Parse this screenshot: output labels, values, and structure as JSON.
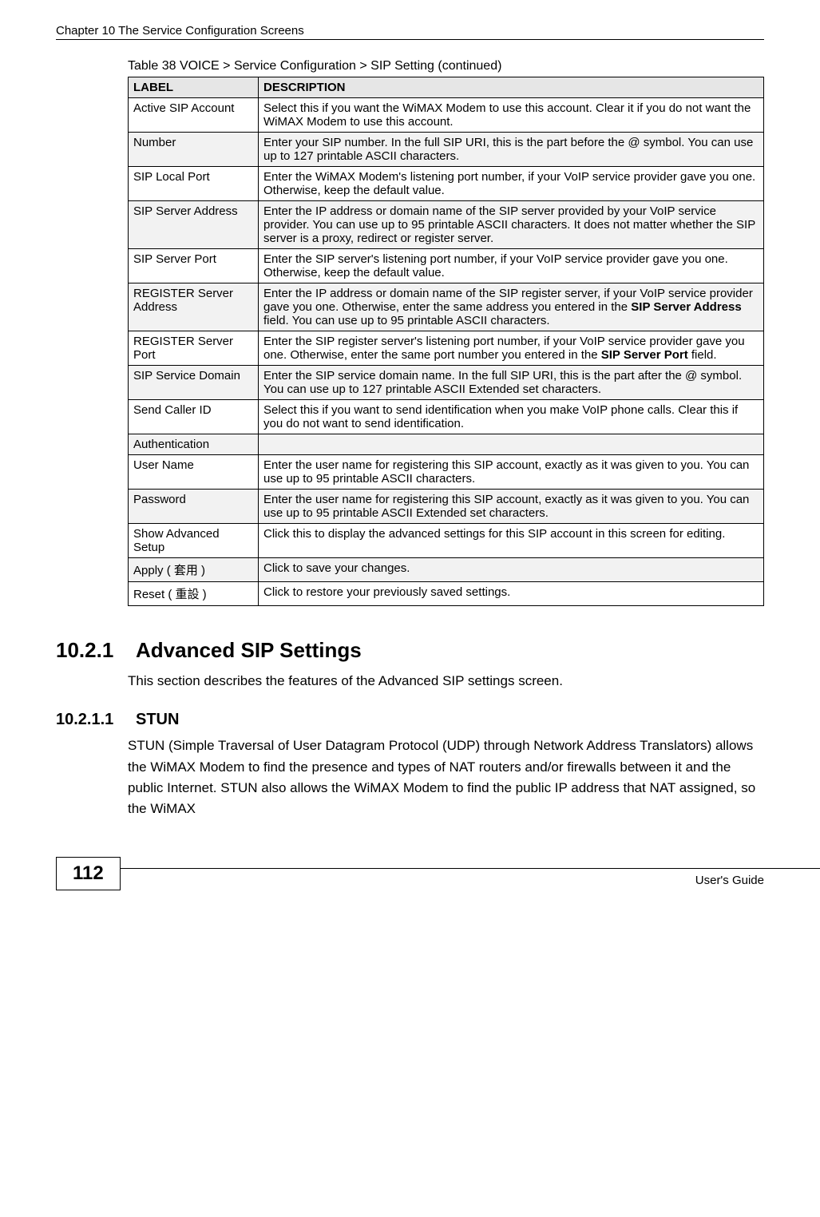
{
  "chapterTitle": "Chapter 10 The Service Configuration Screens",
  "tableCaption": "Table 38   VOICE > Service Configuration > SIP Setting (continued)",
  "headers": {
    "label": "LABEL",
    "description": "DESCRIPTION"
  },
  "rows": [
    {
      "label": "Active SIP Account",
      "indent": false,
      "shade": false,
      "desc": "Select this if you want the WiMAX Modem to use this account. Clear it if you do not want the WiMAX Modem to use this account."
    },
    {
      "label": "Number",
      "indent": true,
      "shade": true,
      "desc": "Enter your SIP number. In the full SIP URI, this is the part before the @ symbol.  You can use up to 127 printable ASCII characters."
    },
    {
      "label": "SIP Local Port",
      "indent": true,
      "shade": false,
      "desc": "Enter the WiMAX Modem's listening port number, if your VoIP service provider gave you one. Otherwise, keep the default value."
    },
    {
      "label": "SIP Server Address",
      "indent": true,
      "shade": true,
      "desc": "Enter the IP address or domain name of the SIP server provided by your VoIP service provider. You can use up to 95 printable ASCII characters. It does not matter whether the SIP server is a proxy, redirect or register server."
    },
    {
      "label": "SIP Server Port",
      "indent": true,
      "shade": false,
      "desc": "Enter the SIP server's listening port number, if your VoIP service provider gave you one. Otherwise, keep the default value."
    },
    {
      "label": "REGISTER Server Address",
      "indent": true,
      "shade": true,
      "descParts": [
        "Enter the IP address or domain name of the SIP register server, if your VoIP service provider gave you one. Otherwise, enter the same address you entered in the ",
        "SIP Server Address",
        " field. You can use up to 95 printable ASCII characters."
      ]
    },
    {
      "label": "REGISTER Server Port",
      "indent": true,
      "shade": false,
      "descParts": [
        "Enter the SIP register server's listening port number, if your VoIP service provider gave you one. Otherwise, enter the same port number you entered in the ",
        "SIP Server Port",
        " field."
      ]
    },
    {
      "label": "SIP Service Domain",
      "indent": true,
      "shade": true,
      "desc": "Enter the SIP service domain name. In the full SIP URI, this is the part after the @ symbol.  You can use up to 127 printable ASCII Extended set characters."
    },
    {
      "label": "Send Caller ID",
      "indent": false,
      "shade": false,
      "desc": "Select this if you want to send identification when you make VoIP phone calls. Clear this if you do not want to send identification."
    },
    {
      "label": "Authentication",
      "indent": false,
      "shade": true,
      "desc": ""
    },
    {
      "label": "User Name",
      "indent": false,
      "shade": false,
      "desc": "Enter the user name for registering this SIP account, exactly as it was given to you. You can use up to 95 printable ASCII characters."
    },
    {
      "label": "Password",
      "indent": false,
      "shade": true,
      "desc": "Enter the user name for registering this SIP account, exactly as it was given to you. You can use up to 95 printable ASCII Extended set characters."
    },
    {
      "label": "Show Advanced Setup",
      "indent": false,
      "shade": false,
      "desc": "Click this to display the advanced settings for this SIP account in this screen for editing."
    },
    {
      "label": "Apply ( 套用 )",
      "indent": false,
      "shade": true,
      "desc": "Click to save your changes."
    },
    {
      "label": "Reset ( 重設 )",
      "indent": false,
      "shade": false,
      "desc": "Click to restore your previously saved settings."
    }
  ],
  "section": {
    "num": "10.2.1",
    "title": "Advanced SIP Settings",
    "body": "This section describes the features of the Advanced SIP settings screen."
  },
  "subsection": {
    "num": "10.2.1.1",
    "title": "STUN",
    "body": "STUN (Simple Traversal of User Datagram Protocol (UDP) through Network Address Translators) allows the WiMAX Modem to find the presence and types of NAT routers and/or firewalls between it and the public Internet. STUN also allows the WiMAX Modem to find the public IP address that NAT assigned, so the WiMAX"
  },
  "pageNumber": "112",
  "footerGuide": "User's Guide"
}
